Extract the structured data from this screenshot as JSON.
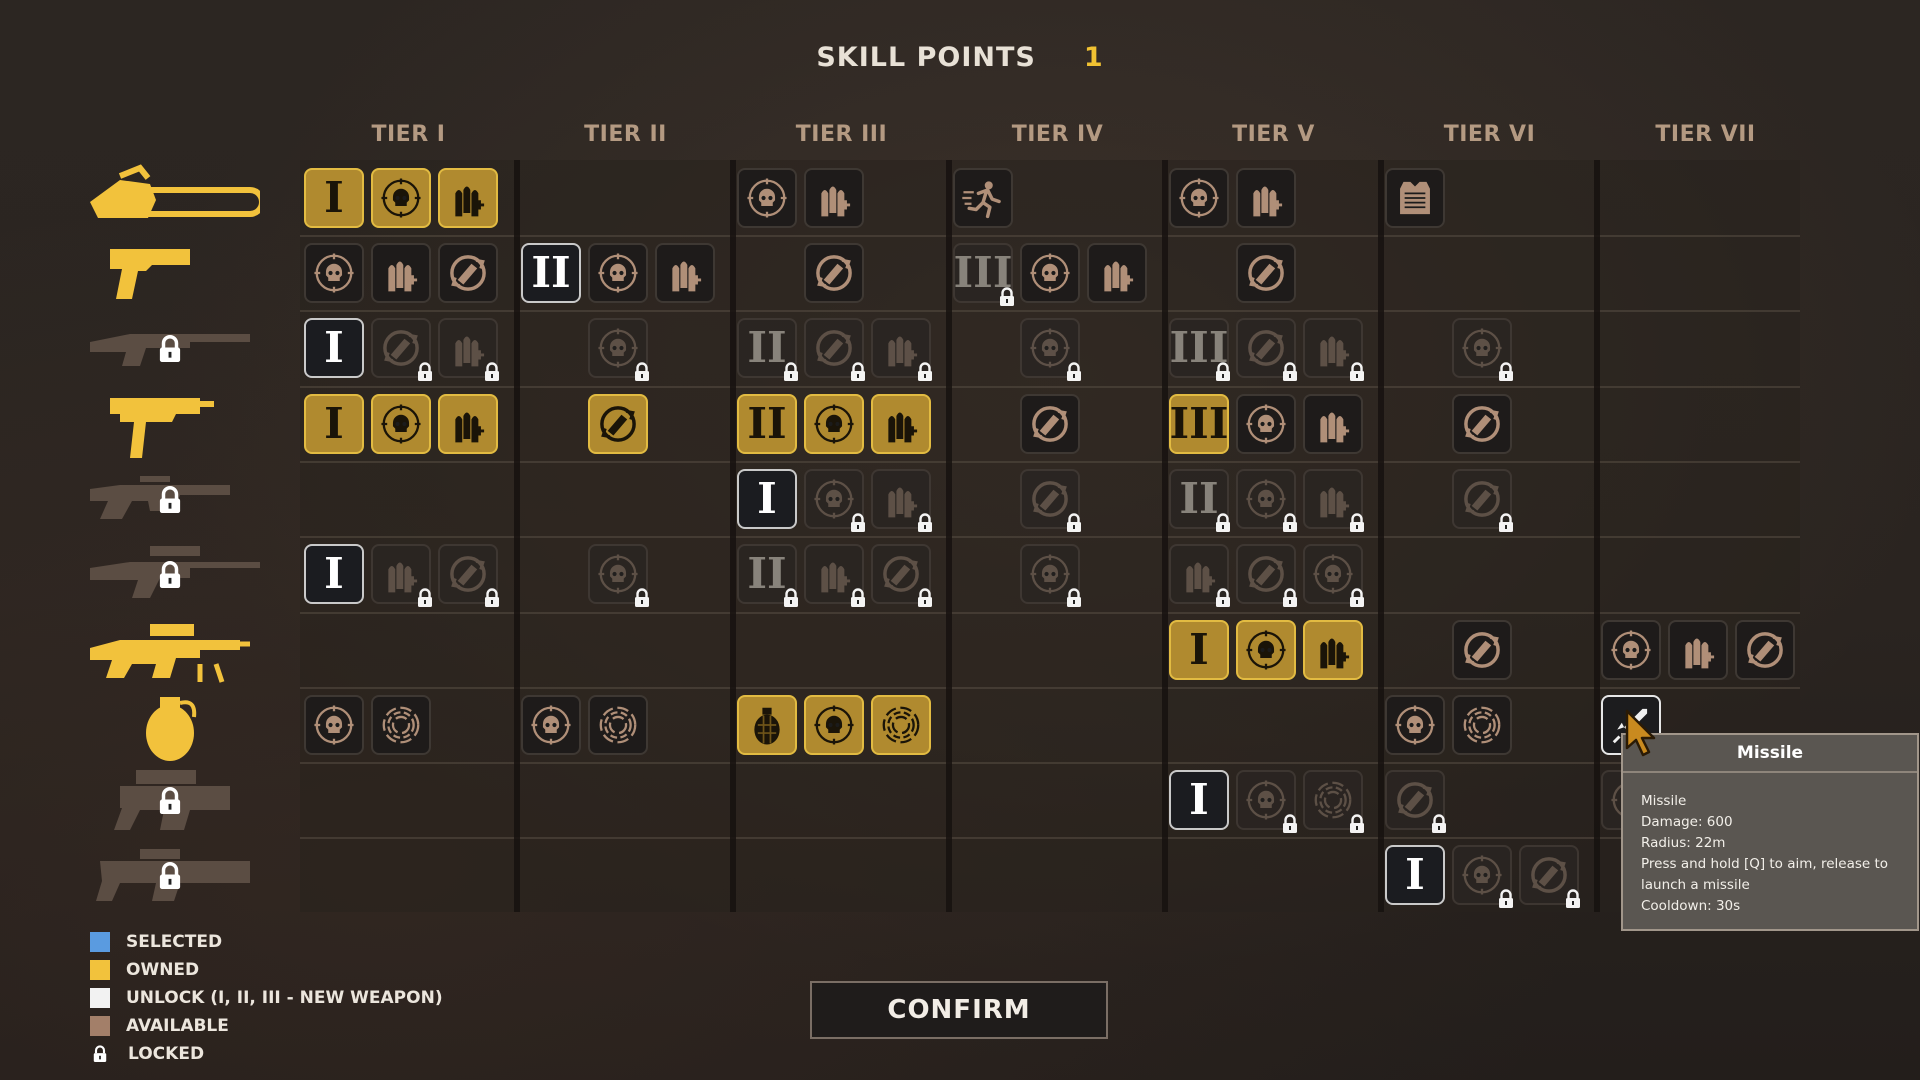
{
  "header": {
    "label": "SKILL POINTS",
    "points": "1"
  },
  "tiers": [
    "TIER I",
    "TIER II",
    "TIER III",
    "TIER IV",
    "TIER V",
    "TIER VI",
    "TIER VII"
  ],
  "legend": [
    {
      "label": "SELECTED",
      "color": "#5a9be0"
    },
    {
      "label": "OWNED",
      "color": "#f2c23c"
    },
    {
      "label": "UNLOCK (I, II, III - NEW WEAPON)",
      "color": "#f2f2f2"
    },
    {
      "label": "AVAILABLE",
      "color": "#a37f69"
    },
    {
      "label": "LOCKED",
      "icon": "lock-icon"
    }
  ],
  "confirm_label": "CONFIRM",
  "tooltip": {
    "title": "Missile",
    "lines": [
      "Missile",
      "Damage: 600",
      "Radius: 22m",
      "Press and hold [Q] to aim, release to",
      "launch a missile",
      "Cooldown: 30s"
    ]
  },
  "weapons": [
    {
      "name": "chainsaw",
      "status": "owned"
    },
    {
      "name": "pistol",
      "status": "owned"
    },
    {
      "name": "shotgun",
      "status": "locked"
    },
    {
      "name": "uzi",
      "status": "owned"
    },
    {
      "name": "assault-rifle",
      "status": "locked"
    },
    {
      "name": "sniper-rifle",
      "status": "locked"
    },
    {
      "name": "machine-gun",
      "status": "owned"
    },
    {
      "name": "grenade",
      "status": "owned"
    },
    {
      "name": "grenade-launcher",
      "status": "locked"
    },
    {
      "name": "rocket-launcher",
      "status": "locked"
    }
  ],
  "skills": [
    {
      "row": 0,
      "tier": 0,
      "slot": 0,
      "icon": "roman",
      "text": "I",
      "state": "owned"
    },
    {
      "row": 0,
      "tier": 0,
      "slot": 1,
      "icon": "skull",
      "state": "owned"
    },
    {
      "row": 0,
      "tier": 0,
      "slot": 2,
      "icon": "ammo",
      "state": "owned"
    },
    {
      "row": 0,
      "tier": 2,
      "slot": 0,
      "icon": "skull",
      "state": "available"
    },
    {
      "row": 0,
      "tier": 2,
      "slot": 1,
      "icon": "ammo",
      "state": "available"
    },
    {
      "row": 0,
      "tier": 3,
      "slot": 0,
      "icon": "sprint",
      "state": "available"
    },
    {
      "row": 0,
      "tier": 4,
      "slot": 0,
      "icon": "skull",
      "state": "available"
    },
    {
      "row": 0,
      "tier": 4,
      "slot": 1,
      "icon": "ammo",
      "state": "available"
    },
    {
      "row": 0,
      "tier": 5,
      "slot": 0,
      "icon": "armor",
      "state": "available"
    },
    {
      "row": 1,
      "tier": 0,
      "slot": 0,
      "icon": "skull",
      "state": "available"
    },
    {
      "row": 1,
      "tier": 0,
      "slot": 1,
      "icon": "ammo",
      "state": "available"
    },
    {
      "row": 1,
      "tier": 0,
      "slot": 2,
      "icon": "reload",
      "state": "available"
    },
    {
      "row": 1,
      "tier": 1,
      "slot": 0,
      "icon": "roman",
      "text": "II",
      "state": "unlock"
    },
    {
      "row": 1,
      "tier": 1,
      "slot": 1,
      "icon": "skull",
      "state": "available"
    },
    {
      "row": 1,
      "tier": 1,
      "slot": 2,
      "icon": "ammo",
      "state": "available"
    },
    {
      "row": 1,
      "tier": 2,
      "slot": 1,
      "icon": "reload",
      "state": "available"
    },
    {
      "row": 1,
      "tier": 3,
      "slot": 0,
      "icon": "roman",
      "text": "III",
      "state": "locked"
    },
    {
      "row": 1,
      "tier": 3,
      "slot": 1,
      "icon": "skull",
      "state": "available"
    },
    {
      "row": 1,
      "tier": 3,
      "slot": 2,
      "icon": "ammo",
      "state": "available"
    },
    {
      "row": 1,
      "tier": 4,
      "slot": 1,
      "icon": "reload",
      "state": "available"
    },
    {
      "row": 2,
      "tier": 0,
      "slot": 0,
      "icon": "roman",
      "text": "I",
      "state": "unlock"
    },
    {
      "row": 2,
      "tier": 0,
      "slot": 1,
      "icon": "reload",
      "state": "locked"
    },
    {
      "row": 2,
      "tier": 0,
      "slot": 2,
      "icon": "ammo",
      "state": "locked"
    },
    {
      "row": 2,
      "tier": 1,
      "slot": 1,
      "icon": "skull",
      "state": "locked"
    },
    {
      "row": 2,
      "tier": 2,
      "slot": 0,
      "icon": "roman",
      "text": "II",
      "state": "locked"
    },
    {
      "row": 2,
      "tier": 2,
      "slot": 1,
      "icon": "reload",
      "state": "locked"
    },
    {
      "row": 2,
      "tier": 2,
      "slot": 2,
      "icon": "ammo",
      "state": "locked"
    },
    {
      "row": 2,
      "tier": 3,
      "slot": 1,
      "icon": "skull",
      "state": "locked"
    },
    {
      "row": 2,
      "tier": 4,
      "slot": 0,
      "icon": "roman",
      "text": "III",
      "state": "locked"
    },
    {
      "row": 2,
      "tier": 4,
      "slot": 1,
      "icon": "reload",
      "state": "locked"
    },
    {
      "row": 2,
      "tier": 4,
      "slot": 2,
      "icon": "ammo",
      "state": "locked"
    },
    {
      "row": 2,
      "tier": 5,
      "slot": 1,
      "icon": "skull",
      "state": "locked"
    },
    {
      "row": 3,
      "tier": 0,
      "slot": 0,
      "icon": "roman",
      "text": "I",
      "state": "owned"
    },
    {
      "row": 3,
      "tier": 0,
      "slot": 1,
      "icon": "skull",
      "state": "owned"
    },
    {
      "row": 3,
      "tier": 0,
      "slot": 2,
      "icon": "ammo",
      "state": "owned"
    },
    {
      "row": 3,
      "tier": 1,
      "slot": 1,
      "icon": "reload",
      "state": "owned"
    },
    {
      "row": 3,
      "tier": 2,
      "slot": 0,
      "icon": "roman",
      "text": "II",
      "state": "owned"
    },
    {
      "row": 3,
      "tier": 2,
      "slot": 1,
      "icon": "skull",
      "state": "owned"
    },
    {
      "row": 3,
      "tier": 2,
      "slot": 2,
      "icon": "ammo",
      "state": "owned"
    },
    {
      "row": 3,
      "tier": 3,
      "slot": 1,
      "icon": "reload",
      "state": "available"
    },
    {
      "row": 3,
      "tier": 4,
      "slot": 0,
      "icon": "roman",
      "text": "III",
      "state": "owned"
    },
    {
      "row": 3,
      "tier": 4,
      "slot": 1,
      "icon": "skull",
      "state": "available"
    },
    {
      "row": 3,
      "tier": 4,
      "slot": 2,
      "icon": "ammo",
      "state": "available"
    },
    {
      "row": 3,
      "tier": 5,
      "slot": 1,
      "icon": "reload",
      "state": "available"
    },
    {
      "row": 4,
      "tier": 2,
      "slot": 0,
      "icon": "roman",
      "text": "I",
      "state": "unlock"
    },
    {
      "row": 4,
      "tier": 2,
      "slot": 1,
      "icon": "skull",
      "state": "locked"
    },
    {
      "row": 4,
      "tier": 2,
      "slot": 2,
      "icon": "ammo",
      "state": "locked"
    },
    {
      "row": 4,
      "tier": 3,
      "slot": 1,
      "icon": "reload",
      "state": "locked"
    },
    {
      "row": 4,
      "tier": 4,
      "slot": 0,
      "icon": "roman",
      "text": "II",
      "state": "locked"
    },
    {
      "row": 4,
      "tier": 4,
      "slot": 1,
      "icon": "skull",
      "state": "locked"
    },
    {
      "row": 4,
      "tier": 4,
      "slot": 2,
      "icon": "ammo",
      "state": "locked"
    },
    {
      "row": 4,
      "tier": 5,
      "slot": 1,
      "icon": "reload",
      "state": "locked"
    },
    {
      "row": 5,
      "tier": 0,
      "slot": 0,
      "icon": "roman",
      "text": "I",
      "state": "unlock"
    },
    {
      "row": 5,
      "tier": 0,
      "slot": 1,
      "icon": "ammo",
      "state": "locked"
    },
    {
      "row": 5,
      "tier": 0,
      "slot": 2,
      "icon": "reload",
      "state": "locked"
    },
    {
      "row": 5,
      "tier": 1,
      "slot": 1,
      "icon": "skull",
      "state": "locked"
    },
    {
      "row": 5,
      "tier": 2,
      "slot": 0,
      "icon": "roman",
      "text": "II",
      "state": "locked"
    },
    {
      "row": 5,
      "tier": 2,
      "slot": 1,
      "icon": "ammo",
      "state": "locked"
    },
    {
      "row": 5,
      "tier": 2,
      "slot": 2,
      "icon": "reload",
      "state": "locked"
    },
    {
      "row": 5,
      "tier": 3,
      "slot": 1,
      "icon": "skull",
      "state": "locked"
    },
    {
      "row": 5,
      "tier": 4,
      "slot": 0,
      "icon": "ammo",
      "state": "locked"
    },
    {
      "row": 5,
      "tier": 4,
      "slot": 1,
      "icon": "reload",
      "state": "locked"
    },
    {
      "row": 5,
      "tier": 4,
      "slot": 2,
      "icon": "skull",
      "state": "locked"
    },
    {
      "row": 6,
      "tier": 4,
      "slot": 0,
      "icon": "roman",
      "text": "I",
      "state": "owned"
    },
    {
      "row": 6,
      "tier": 4,
      "slot": 1,
      "icon": "skull",
      "state": "owned"
    },
    {
      "row": 6,
      "tier": 4,
      "slot": 2,
      "icon": "ammo",
      "state": "owned"
    },
    {
      "row": 6,
      "tier": 5,
      "slot": 1,
      "icon": "reload",
      "state": "available"
    },
    {
      "row": 6,
      "tier": 6,
      "slot": 0,
      "icon": "skull",
      "state": "available"
    },
    {
      "row": 6,
      "tier": 6,
      "slot": 1,
      "icon": "ammo",
      "state": "available"
    },
    {
      "row": 6,
      "tier": 6,
      "slot": 2,
      "icon": "reload",
      "state": "available"
    },
    {
      "row": 7,
      "tier": 0,
      "slot": 0,
      "icon": "skull",
      "state": "available"
    },
    {
      "row": 7,
      "tier": 0,
      "slot": 1,
      "icon": "vortex",
      "state": "available"
    },
    {
      "row": 7,
      "tier": 1,
      "slot": 0,
      "icon": "skull",
      "state": "available"
    },
    {
      "row": 7,
      "tier": 1,
      "slot": 1,
      "icon": "vortex",
      "state": "available"
    },
    {
      "row": 7,
      "tier": 2,
      "slot": 0,
      "icon": "grenade",
      "state": "owned"
    },
    {
      "row": 7,
      "tier": 2,
      "slot": 1,
      "icon": "skull",
      "state": "owned"
    },
    {
      "row": 7,
      "tier": 2,
      "slot": 2,
      "icon": "vortex",
      "state": "owned"
    },
    {
      "row": 7,
      "tier": 5,
      "slot": 0,
      "icon": "skull",
      "state": "available"
    },
    {
      "row": 7,
      "tier": 5,
      "slot": 1,
      "icon": "vortex",
      "state": "available"
    },
    {
      "row": 7,
      "tier": 6,
      "slot": 0,
      "icon": "missile",
      "state": "selected"
    },
    {
      "row": 8,
      "tier": 4,
      "slot": 0,
      "icon": "roman",
      "text": "I",
      "state": "unlock"
    },
    {
      "row": 8,
      "tier": 4,
      "slot": 1,
      "icon": "skull",
      "state": "locked"
    },
    {
      "row": 8,
      "tier": 4,
      "slot": 2,
      "icon": "vortex",
      "state": "locked"
    },
    {
      "row": 8,
      "tier": 5,
      "slot": 0,
      "icon": "reload",
      "state": "locked"
    },
    {
      "row": 8,
      "tier": 6,
      "slot": 0,
      "icon": "skull",
      "state": "locked"
    },
    {
      "row": 9,
      "tier": 5,
      "slot": 0,
      "icon": "roman",
      "text": "I",
      "state": "unlock"
    },
    {
      "row": 9,
      "tier": 5,
      "slot": 1,
      "icon": "skull",
      "state": "locked"
    },
    {
      "row": 9,
      "tier": 5,
      "slot": 2,
      "icon": "reload",
      "state": "locked"
    }
  ]
}
